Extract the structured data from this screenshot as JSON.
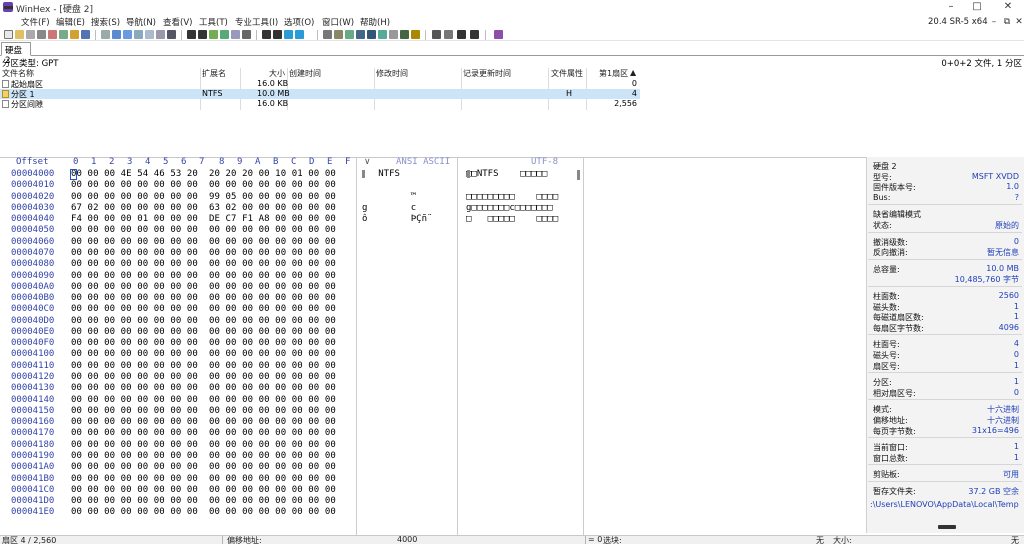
{
  "window": {
    "title": "WinHex - [硬盘 2]",
    "version": "20.4 SR-5 x64",
    "buttons": {
      "minimize": "–",
      "maximize": "□",
      "close": "✕"
    }
  },
  "menu": {
    "items": [
      "文件(F)",
      "编辑(E)",
      "搜索(S)",
      "导航(N)",
      "查看(V)",
      "工具(T)",
      "专业工具(I)",
      "选项(O)",
      "窗口(W)",
      "帮助(H)"
    ],
    "doc_buttons": {
      "minimize": "–",
      "restore": "⧉",
      "close": "✕"
    }
  },
  "tab": {
    "label": "硬盘 2"
  },
  "info_strip": {
    "partition_type": "分区类型: GPT",
    "file_count": "0+0+2 文件, 1 分区"
  },
  "directory": {
    "headers": {
      "name": "文件名称",
      "ext": "扩展名",
      "size": "大小",
      "created": "创建时间",
      "modified": "修改时间",
      "accessed": "记录更新时间",
      "attr": "文件属性",
      "first_sector": "第1扇区"
    },
    "sort_indicator": "▲",
    "rows": [
      {
        "name": "起始扇区",
        "ext": "",
        "size": "16.0 KB",
        "attr": "",
        "first_sector": "0"
      },
      {
        "name": "分区 1",
        "ext": "NTFS",
        "size": "10.0 MB",
        "attr": "H",
        "first_sector": "4"
      },
      {
        "name": "分区间隙",
        "ext": "",
        "size": "16.0 KB",
        "attr": "",
        "first_sector": "2,556"
      }
    ]
  },
  "hex_view": {
    "offset_label": "Offset",
    "column_headers": [
      "0",
      "1",
      "2",
      "3",
      "4",
      "5",
      "6",
      "7",
      "8",
      "9",
      "A",
      "B",
      "C",
      "D",
      "E",
      "F"
    ],
    "ansi_button": "∨",
    "ansi_label": "ANSI ASCII",
    "utf_label": "UTF-8",
    "offsets": [
      "00004000",
      "00004010",
      "00004020",
      "00004030",
      "00004040",
      "00004050",
      "00004060",
      "00004070",
      "00004080",
      "00004090",
      "000040A0",
      "000040B0",
      "000040C0",
      "000040D0",
      "000040E0",
      "000040F0",
      "00004100",
      "00004110",
      "00004120",
      "00004130",
      "00004140",
      "00004150",
      "00004160",
      "00004170",
      "00004180",
      "00004190",
      "000041A0",
      "000041B0",
      "000041C0",
      "000041D0",
      "000041E0"
    ],
    "hex": [
      "00 00 00 4E 54 46 53 20  20 20 20 00 10 01 00 00",
      "00 00 00 00 00 00 00 00  00 00 00 00 00 00 00 00",
      "00 00 00 00 00 00 00 00  99 05 00 00 00 00 00 00",
      "67 02 00 00 00 00 00 00  63 02 00 00 00 00 00 00",
      "F4 00 00 00 01 00 00 00  DE C7 F1 A8 00 00 00 00",
      "00 00 00 00 00 00 00 00  00 00 00 00 00 00 00 00",
      "00 00 00 00 00 00 00 00  00 00 00 00 00 00 00 00",
      "00 00 00 00 00 00 00 00  00 00 00 00 00 00 00 00",
      "00 00 00 00 00 00 00 00  00 00 00 00 00 00 00 00",
      "00 00 00 00 00 00 00 00  00 00 00 00 00 00 00 00",
      "00 00 00 00 00 00 00 00  00 00 00 00 00 00 00 00",
      "00 00 00 00 00 00 00 00  00 00 00 00 00 00 00 00",
      "00 00 00 00 00 00 00 00  00 00 00 00 00 00 00 00",
      "00 00 00 00 00 00 00 00  00 00 00 00 00 00 00 00",
      "00 00 00 00 00 00 00 00  00 00 00 00 00 00 00 00",
      "00 00 00 00 00 00 00 00  00 00 00 00 00 00 00 00",
      "00 00 00 00 00 00 00 00  00 00 00 00 00 00 00 00",
      "00 00 00 00 00 00 00 00  00 00 00 00 00 00 00 00",
      "00 00 00 00 00 00 00 00  00 00 00 00 00 00 00 00",
      "00 00 00 00 00 00 00 00  00 00 00 00 00 00 00 00",
      "00 00 00 00 00 00 00 00  00 00 00 00 00 00 00 00",
      "00 00 00 00 00 00 00 00  00 00 00 00 00 00 00 00",
      "00 00 00 00 00 00 00 00  00 00 00 00 00 00 00 00",
      "00 00 00 00 00 00 00 00  00 00 00 00 00 00 00 00",
      "00 00 00 00 00 00 00 00  00 00 00 00 00 00 00 00",
      "00 00 00 00 00 00 00 00  00 00 00 00 00 00 00 00",
      "00 00 00 00 00 00 00 00  00 00 00 00 00 00 00 00",
      "00 00 00 00 00 00 00 00  00 00 00 00 00 00 00 00",
      "00 00 00 00 00 00 00 00  00 00 00 00 00 00 00 00",
      "00 00 00 00 00 00 00 00  00 00 00 00 00 00 00 00",
      "00 00 00 00 00 00 00 00  00 00 00 00 00 00 00 00"
    ],
    "ansi": [
      "   NTFS",
      "",
      "         ™",
      "g        c",
      "ô        ÞÇñ¨"
    ],
    "utf8": [
      "□□NTFS    □□□□□",
      "",
      "□□□□□□□□□    □□□□",
      "g□□□□□□□c□□□□□□□",
      "□   □□□□□    □□□□"
    ]
  },
  "panel": {
    "groups": [
      [
        {
          "label": "硬盘 2",
          "value": ""
        },
        {
          "label": "型号:",
          "value": "MSFT XVDD"
        },
        {
          "label": "固件版本号:",
          "value": "1.0"
        },
        {
          "label": "Bus:",
          "value": "?"
        }
      ],
      [
        {
          "label": "缺省编辑模式",
          "value": ""
        },
        {
          "label": "状态:",
          "value": "原始的"
        }
      ],
      [
        {
          "label": "撤消级数:",
          "value": "0"
        },
        {
          "label": "反向撤消:",
          "value": "暂无信息"
        }
      ],
      [
        {
          "label": "总容量:",
          "value": "10.0 MB"
        },
        {
          "label": "",
          "value": "10,485,760 字节"
        }
      ],
      [
        {
          "label": "柱面数:",
          "value": "2560"
        },
        {
          "label": "磁头数:",
          "value": "1"
        },
        {
          "label": "每磁道扇区数:",
          "value": "1"
        },
        {
          "label": "每扇区字节数:",
          "value": "4096"
        }
      ],
      [
        {
          "label": "柱面号:",
          "value": "4"
        },
        {
          "label": "磁头号:",
          "value": "0"
        },
        {
          "label": "扇区号:",
          "value": "1"
        }
      ],
      [
        {
          "label": "分区:",
          "value": "1"
        },
        {
          "label": "相对扇区号:",
          "value": "0"
        }
      ],
      [
        {
          "label": "模式:",
          "value": "十六进制"
        },
        {
          "label": "偏移地址:",
          "value": "十六进制"
        },
        {
          "label": "每页字节数:",
          "value": "31x16=496"
        }
      ],
      [
        {
          "label": "当前窗口:",
          "value": "1"
        },
        {
          "label": "窗口总数:",
          "value": "1"
        }
      ],
      [
        {
          "label": "剪贴板:",
          "value": "可用"
        }
      ],
      [
        {
          "label": "暂存文件夹:",
          "value": "37.2 GB 空余"
        }
      ]
    ],
    "temp_path": ":\\Users\\LENOVO\\AppData\\Local\\Temp"
  },
  "status": {
    "sector": "扇区 4 / 2,560",
    "offset_label": "偏移地址:",
    "offset_value": "4000",
    "selection_prefix": "= 0",
    "selection_label": "选块:",
    "none1": "无",
    "size_label": "大小:",
    "none2": "无"
  },
  "colors": {
    "selection": "#cce4f7",
    "offset_blue": "#3344aa",
    "panel_value_blue": "#1f3fb8",
    "app_icon": "#6a3fb0"
  }
}
